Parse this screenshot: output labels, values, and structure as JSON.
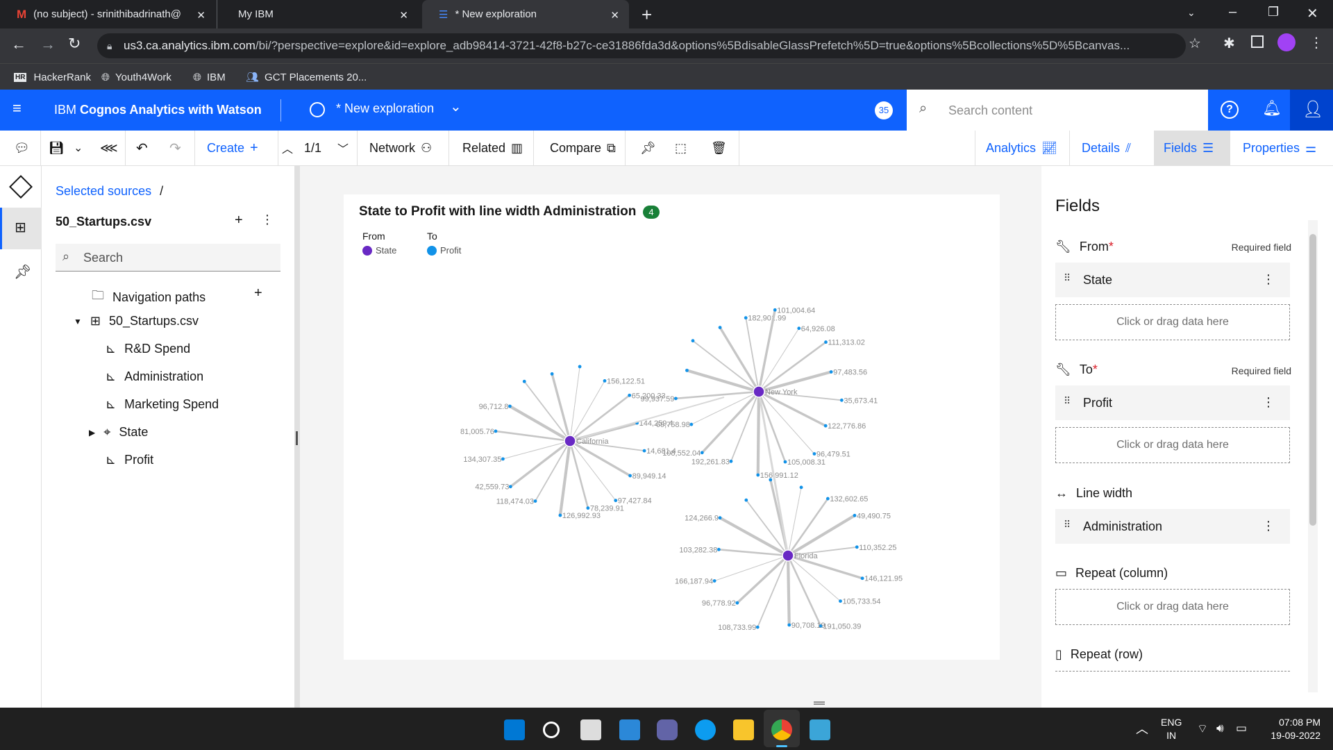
{
  "browser": {
    "tabs": [
      {
        "title": "(no subject) - srinithibadrinath@",
        "icon": "gmail-icon"
      },
      {
        "title": "My IBM",
        "icon": "ibm-icon"
      },
      {
        "title": "* New exploration",
        "icon": "cognos-icon"
      }
    ],
    "url_host": "us3.ca.analytics.ibm.com",
    "url_rest": "/bi/?perspective=explore&id=explore_adb98414-3721-42f8-b27c-ce31886fda3d&options%5BdisableGlassPrefetch%5D=true&options%5Bcollections%5D%5Bcanvas...",
    "bookmarks": [
      "HackerRank",
      "Youth4Work",
      "IBM",
      "GCT Placements 20..."
    ]
  },
  "app": {
    "product": "IBM",
    "product_bold": "Cognos Analytics with Watson",
    "doc_title": "* New exploration",
    "badge": "35",
    "search_placeholder": "Search content"
  },
  "toolbar": {
    "create": "Create",
    "page": "1/1",
    "network": "Network",
    "related": "Related",
    "compare": "Compare",
    "analytics": "Analytics",
    "details": "Details",
    "fields": "Fields",
    "properties": "Properties"
  },
  "sources": {
    "breadcrumb": "Selected sources",
    "breadcrumb_sep": "/",
    "file": "50_Startups.csv",
    "search_placeholder": "Search",
    "nav_paths": "Navigation paths",
    "table": "50_Startups.csv",
    "columns": [
      "R&D Spend",
      "Administration",
      "Marketing Spend",
      "State",
      "Profit"
    ]
  },
  "viz": {
    "title": "State to Profit with line width Administration",
    "count": "4",
    "legend_from": "From",
    "legend_to": "To",
    "from_item": "State",
    "to_item": "Profit",
    "colors": {
      "state": "#6929c4",
      "profit": "#1192e8"
    }
  },
  "chart_data": {
    "type": "network",
    "title": "State to Profit with line width Administration",
    "nodes_from": [
      "California",
      "New York",
      "Florida"
    ],
    "edges": [
      {
        "from": "California",
        "labels": [
          "156,122.51",
          "65,200.33",
          "144,259.4",
          "14,681.4",
          "89,949.14",
          "97,427.84",
          "78,239.91",
          "126,992.93",
          "118,474.03",
          "42,559.73",
          "134,307.35",
          "81,005.76",
          "96,712.8"
        ]
      },
      {
        "from": "New York",
        "labels": [
          "182,901.99",
          "101,004.64",
          "64,926.08",
          "111,313.02",
          "97,483.56",
          "35,673.41",
          "122,776.86",
          "96,479.51",
          "105,008.31",
          "156,991.12",
          "192,261.83",
          "108,552.04",
          "69,758.98",
          "99,937.59"
        ]
      },
      {
        "from": "Florida",
        "labels": [
          "132,602.65",
          "49,490.75",
          "110,352.25",
          "146,121.95",
          "105,733.54",
          "191,050.39",
          "90,708.19",
          "108,733.99",
          "96,778.92",
          "166,187.94",
          "103,282.38",
          "124,266.9"
        ]
      }
    ]
  },
  "fields": {
    "title": "Fields",
    "from_label": "From",
    "to_label": "To",
    "required": "Required field",
    "from_value": "State",
    "to_value": "Profit",
    "drop_hint": "Click or drag data here",
    "line_width_label": "Line width",
    "line_width_value": "Administration",
    "repeat_col": "Repeat (column)",
    "repeat_row": "Repeat (row)"
  },
  "taskbar": {
    "lang": "ENG",
    "region": "IN",
    "time": "07:08 PM",
    "date": "19-09-2022"
  }
}
